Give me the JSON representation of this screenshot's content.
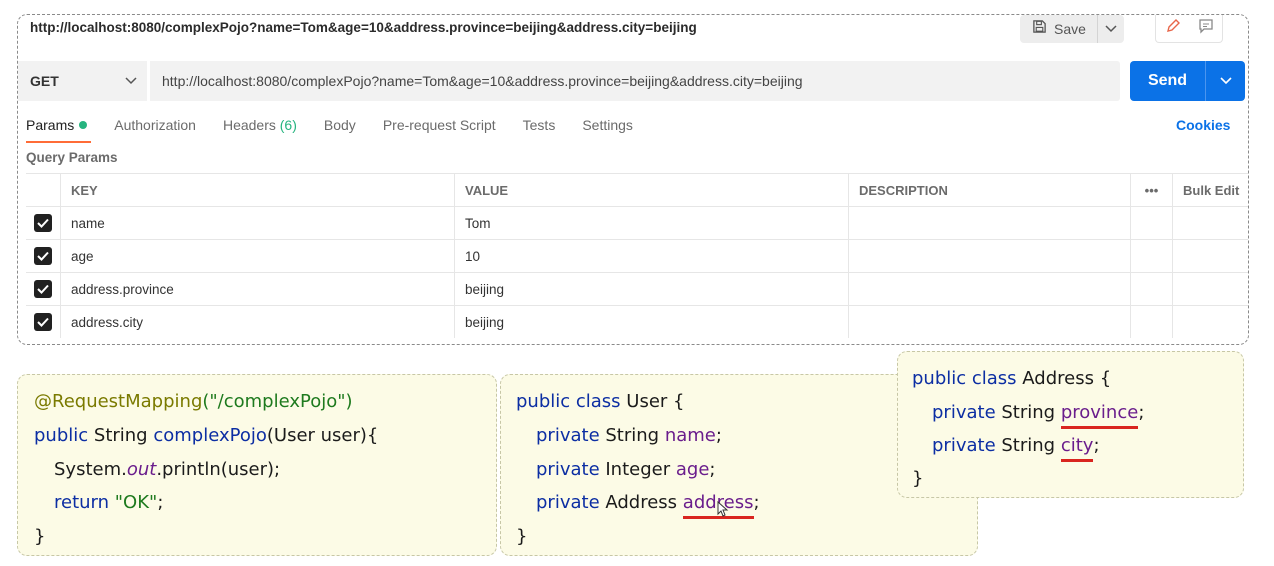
{
  "postman": {
    "title_url": "http://localhost:8080/complexPojo?name=Tom&age=10&address.province=beijing&address.city=beijing",
    "save_label": "Save",
    "method": "GET",
    "url": "http://localhost:8080/complexPojo?name=Tom&age=10&address.province=beijing&address.city=beijing",
    "send_label": "Send",
    "tabs": {
      "params": "Params",
      "authorization": "Authorization",
      "headers": "Headers",
      "headers_count": "(6)",
      "body": "Body",
      "prerequest": "Pre-request Script",
      "tests": "Tests",
      "settings": "Settings"
    },
    "cookies_label": "Cookies",
    "query_params_label": "Query Params",
    "columns": {
      "key": "KEY",
      "value": "VALUE",
      "description": "DESCRIPTION",
      "more": "•••",
      "bulk_edit": "Bulk Edit"
    },
    "params": [
      {
        "key": "name",
        "value": "Tom",
        "checked": true
      },
      {
        "key": "age",
        "value": "10",
        "checked": true
      },
      {
        "key": "address.province",
        "value": "beijing",
        "checked": true
      },
      {
        "key": "address.city",
        "value": "beijing",
        "checked": true
      }
    ]
  },
  "code_controller": {
    "annotation": "@RequestMapping",
    "annotation_arg": "(\"/complexPojo\")",
    "kw_public": "public",
    "ret_type": " String ",
    "method_name": "complexPojo",
    "params": "(User user){",
    "sys_prefix": "System.",
    "sys_out": "out",
    "sys_suffix": ".println(user);",
    "kw_return": "return",
    "ret_value": "\"OK\"",
    "semicolon": ";",
    "close": "}"
  },
  "code_user": {
    "decl_kw": "public class",
    "decl_name": " User {",
    "kw_private": "private",
    "f1_type": " String ",
    "f1_name": "name",
    "f2_type": " Integer ",
    "f2_name": "age",
    "f3_type": " Address ",
    "f3_name": "address",
    "semicolon": ";",
    "close": "}"
  },
  "code_address": {
    "decl_kw": "public class",
    "decl_name": " Address {",
    "kw_private": "private",
    "f1_type": " String ",
    "f1_name": "province",
    "f2_type": " String ",
    "f2_name": "city",
    "semicolon": ";",
    "close": "}"
  },
  "colors": {
    "send": "#0b72e7",
    "tab_underline": "#ff6c37",
    "params_dot": "#26b47f",
    "underline_red": "#d9251f",
    "code_bg": "#fcfbe6"
  }
}
